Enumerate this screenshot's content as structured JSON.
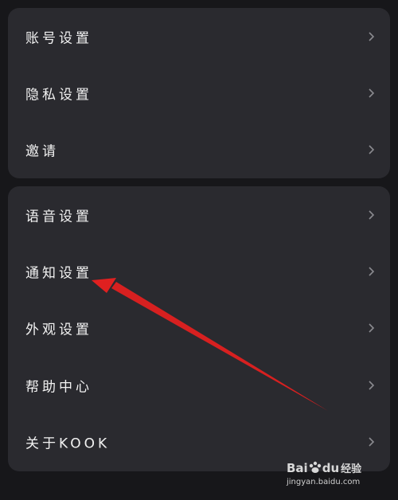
{
  "group_account": {
    "items": [
      {
        "label": "账号设置"
      },
      {
        "label": "隐私设置"
      },
      {
        "label": "邀请"
      }
    ]
  },
  "group_app": {
    "items": [
      {
        "label": "语音设置"
      },
      {
        "label": "通知设置"
      },
      {
        "label": "外观设置"
      },
      {
        "label": "帮助中心"
      },
      {
        "label": "关于KOOK"
      }
    ]
  },
  "icons": {
    "row_chevron": "chevron-right-icon"
  },
  "watermark": {
    "brand_bai": "Bai",
    "brand_du": "du",
    "brand_jingyan": "经验",
    "url": "jingyan.baidu.com"
  },
  "colors": {
    "background": "#17171a",
    "card": "#2a2a2f",
    "text": "#f2f2f2",
    "chevron": "#8a8a8f",
    "annotation_arrow": "#e02020"
  }
}
